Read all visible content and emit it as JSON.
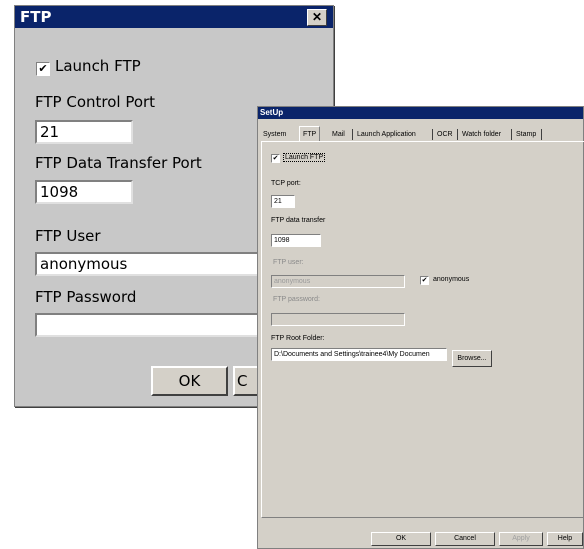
{
  "ftp_dialog": {
    "title": "FTP",
    "close_glyph": "✕",
    "launch_label": "Launch FTP",
    "launch_checked": true,
    "control_port_label": "FTP Control Port",
    "control_port_value": "21",
    "data_port_label": "FTP Data Transfer Port",
    "data_port_value": "1098",
    "user_label": "FTP User",
    "user_value": "anonymous",
    "password_label": "FTP Password",
    "password_value": "",
    "ok_label": "OK",
    "cancel_label": "C"
  },
  "setup_dialog": {
    "title": "SetUp",
    "tabs": [
      {
        "label": "System",
        "active": false
      },
      {
        "label": "FTP",
        "active": true
      },
      {
        "label": "Mail",
        "active": false
      },
      {
        "label": "Launch Application",
        "active": false
      },
      {
        "label": "OCR",
        "active": false
      },
      {
        "label": "Watch folder",
        "active": false
      },
      {
        "label": "Stamp",
        "active": false
      }
    ],
    "launch_label": "Launch FTP",
    "tcp_port_label": "TCP port:",
    "tcp_port_value": "21",
    "data_transfer_label": "FTP data transfer",
    "data_transfer_value": "1098",
    "user_label": "FTP user:",
    "user_value": "anonymous",
    "anonymous_label": "anonymous",
    "password_label": "FTP password:",
    "password_value": "",
    "root_folder_label": "FTP Root Folder:",
    "root_folder_value": "D:\\Documents and Settings\\trainee4\\My Documen",
    "browse_label": "Browse...",
    "buttons": {
      "ok": "OK",
      "cancel": "Cancel",
      "apply": "Apply",
      "help": "Help"
    }
  },
  "colors": {
    "title_bar": "#0a246a",
    "dialog_bg": "#c8c8c8",
    "setup_bg": "#d4d0c8"
  }
}
